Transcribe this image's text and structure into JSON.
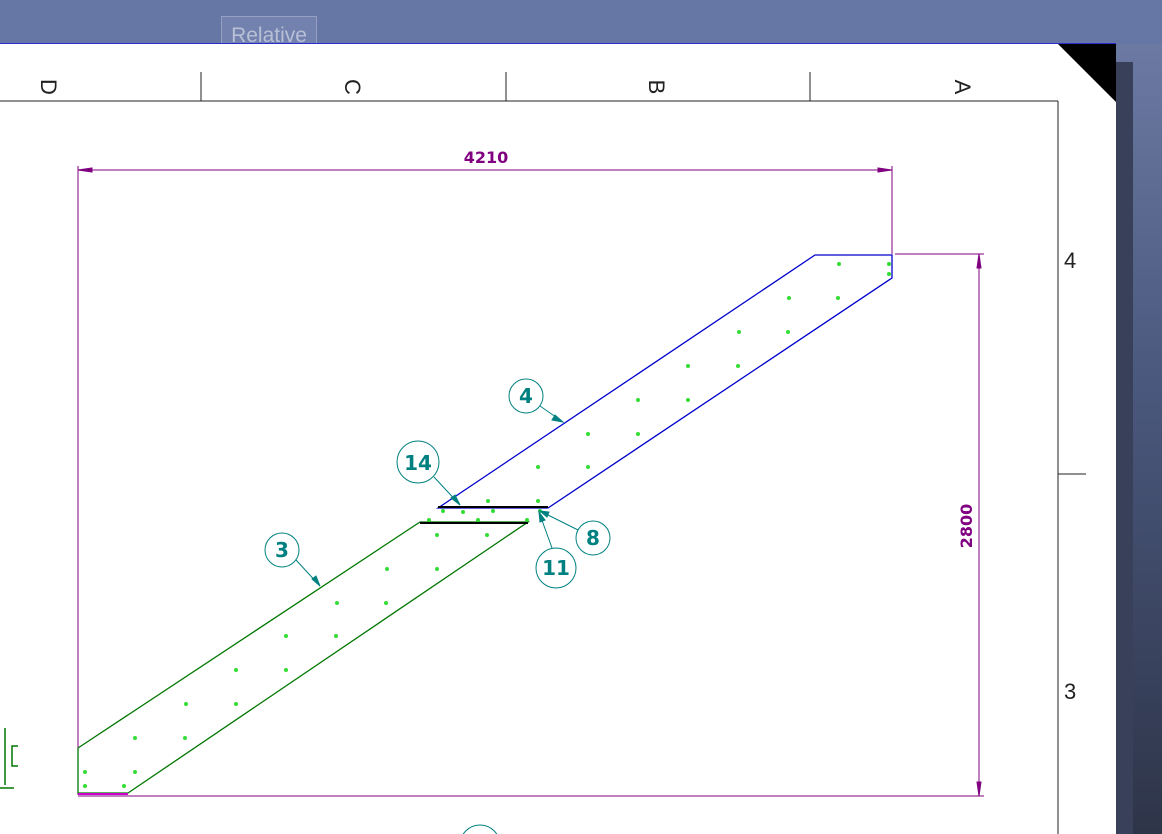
{
  "toolbar": {
    "relative_label": "Relative"
  },
  "frame": {
    "zones_top": [
      "D",
      "C",
      "B",
      "A"
    ],
    "zones_right": [
      "4",
      "3"
    ]
  },
  "dimensions": {
    "horizontal": "4210",
    "vertical": "2800"
  },
  "callouts": {
    "c4": "4",
    "c14": "14",
    "c3": "3",
    "c8": "8",
    "c11": "11"
  },
  "colors": {
    "upper_flight": "#0000cc",
    "lower_flight": "#007700",
    "dimension": "#800080",
    "rebar_dots": "#33dd33",
    "callout": "#008080",
    "landing": "#000000",
    "title_bar": "#6677a6"
  }
}
